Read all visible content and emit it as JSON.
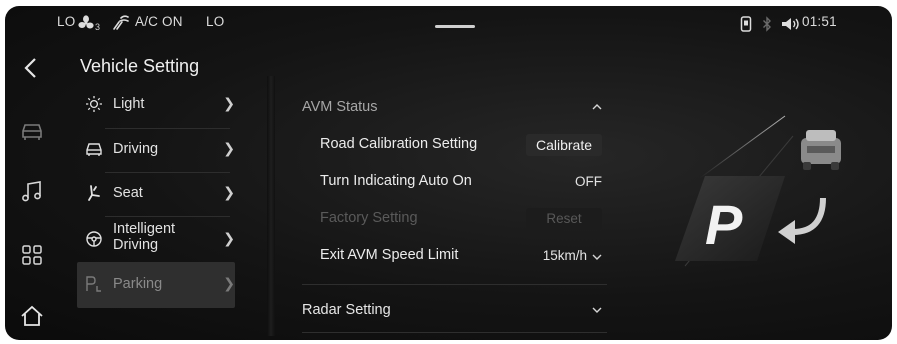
{
  "status_bar": {
    "left_temp": "LO",
    "fan_level": "3",
    "ac_status": "A/C ON",
    "right_temp": "LO",
    "time": "01:51"
  },
  "icons": {
    "fan": "fan-icon",
    "recirculation": "air-recirculation-icon",
    "phone": "phone-icon",
    "bluetooth": "bluetooth-icon",
    "volume": "volume-icon",
    "back": "back-arrow-icon",
    "car": "car-icon",
    "music": "music-note-icon",
    "apps": "apps-grid-icon",
    "home": "home-icon"
  },
  "page": {
    "title": "Vehicle Setting"
  },
  "nav": {
    "items": [
      {
        "label": "Light",
        "icon": "sun-icon"
      },
      {
        "label": "Driving",
        "icon": "car-outline-icon"
      },
      {
        "label": "Seat",
        "icon": "seat-icon"
      },
      {
        "label": "Intelligent Driving",
        "label_line1": "Intelligent",
        "label_line2": "Driving",
        "icon": "steering-wheel-icon"
      },
      {
        "label": "Parking",
        "icon": "parking-icon",
        "active": true
      }
    ]
  },
  "settings": {
    "avm_status": {
      "title": "AVM Status",
      "expanded": true
    },
    "rows": {
      "road_calibration": {
        "label": "Road Calibration Setting",
        "action": "Calibrate"
      },
      "turn_indicating": {
        "label": "Turn Indicating Auto On",
        "value": "OFF"
      },
      "factory_setting": {
        "label": "Factory Setting",
        "action": "Reset",
        "disabled": true
      },
      "exit_avm_speed": {
        "label": "Exit AVM Speed Limit",
        "value": "15km/h"
      }
    },
    "radar": {
      "title": "Radar Setting",
      "expanded": false
    }
  },
  "illustration": {
    "sign_letter": "P"
  },
  "colors": {
    "background": "#141414",
    "text": "#e6e6e6",
    "disabled": "#5a5a5a",
    "active_nav": "#2f2f2f"
  }
}
